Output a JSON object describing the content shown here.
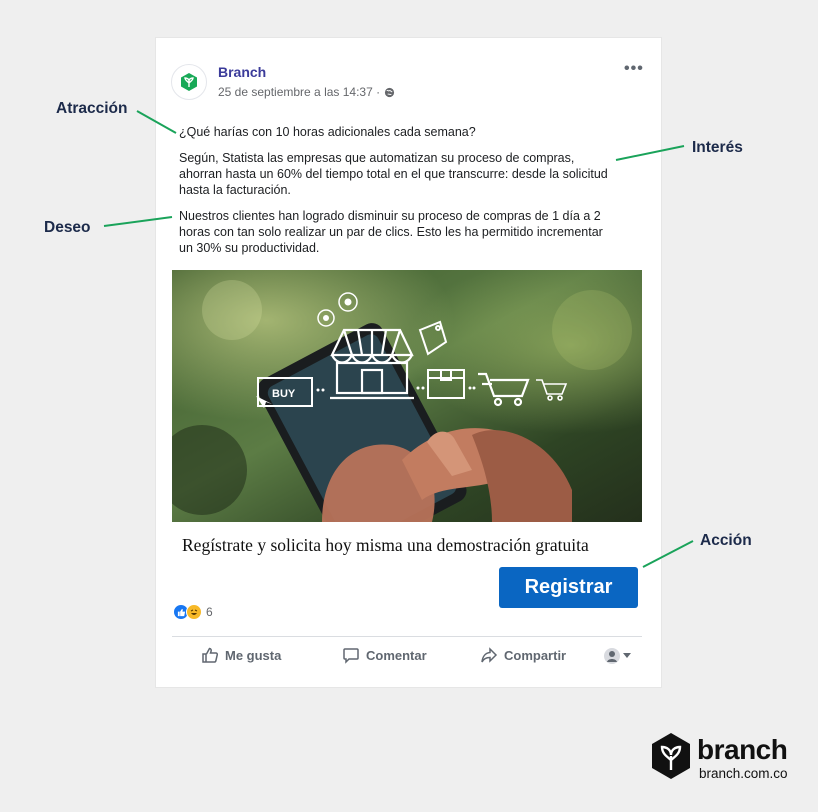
{
  "post": {
    "page_name": "Branch",
    "timestamp": "25 de septiembre a las 14:37 ·",
    "more": "•••",
    "question": "¿Qué harías con 10 horas adicionales cada semana?",
    "paragraph_interest": "Según, Statista las empresas que automatizan su proceso de compras, ahorran hasta un 60% del tiempo total en el que transcurre: desde la solicitud hasta la facturación.",
    "paragraph_desire": "Nuestros clientes han logrado disminuir su proceso de compras de 1 día a 2 horas con tan solo realizar un par de clics. Esto les ha permitido incrementar un 30% su productividad.",
    "image": {
      "buy_label": "BUY"
    },
    "cta_text": "Regístrate y solicita hoy misma una demostración gratuita",
    "cta_button": "Registrar",
    "reactions_count": "6",
    "actions": {
      "like": "Me gusta",
      "comment": "Comentar",
      "share": "Compartir"
    }
  },
  "annotations": {
    "attraction": "Atracción",
    "interest": "Interés",
    "desire": "Deseo",
    "action": "Acción"
  },
  "brand": {
    "name": "branch",
    "url": "branch.com.co"
  },
  "colors": {
    "cta_button": "#0a66c2",
    "callout_line": "#1aa35a",
    "page_name": "#3b3b9a",
    "label_text": "#1c2a4a",
    "like_reaction": "#1877f2",
    "haha_reaction": "#f7b928"
  },
  "icons": [
    "globe-icon",
    "more-icon",
    "shopping-cart-icon",
    "storefront-icon",
    "thumbs-up-icon",
    "comment-icon",
    "share-icon",
    "caret-down-icon",
    "branch-logo-icon"
  ]
}
